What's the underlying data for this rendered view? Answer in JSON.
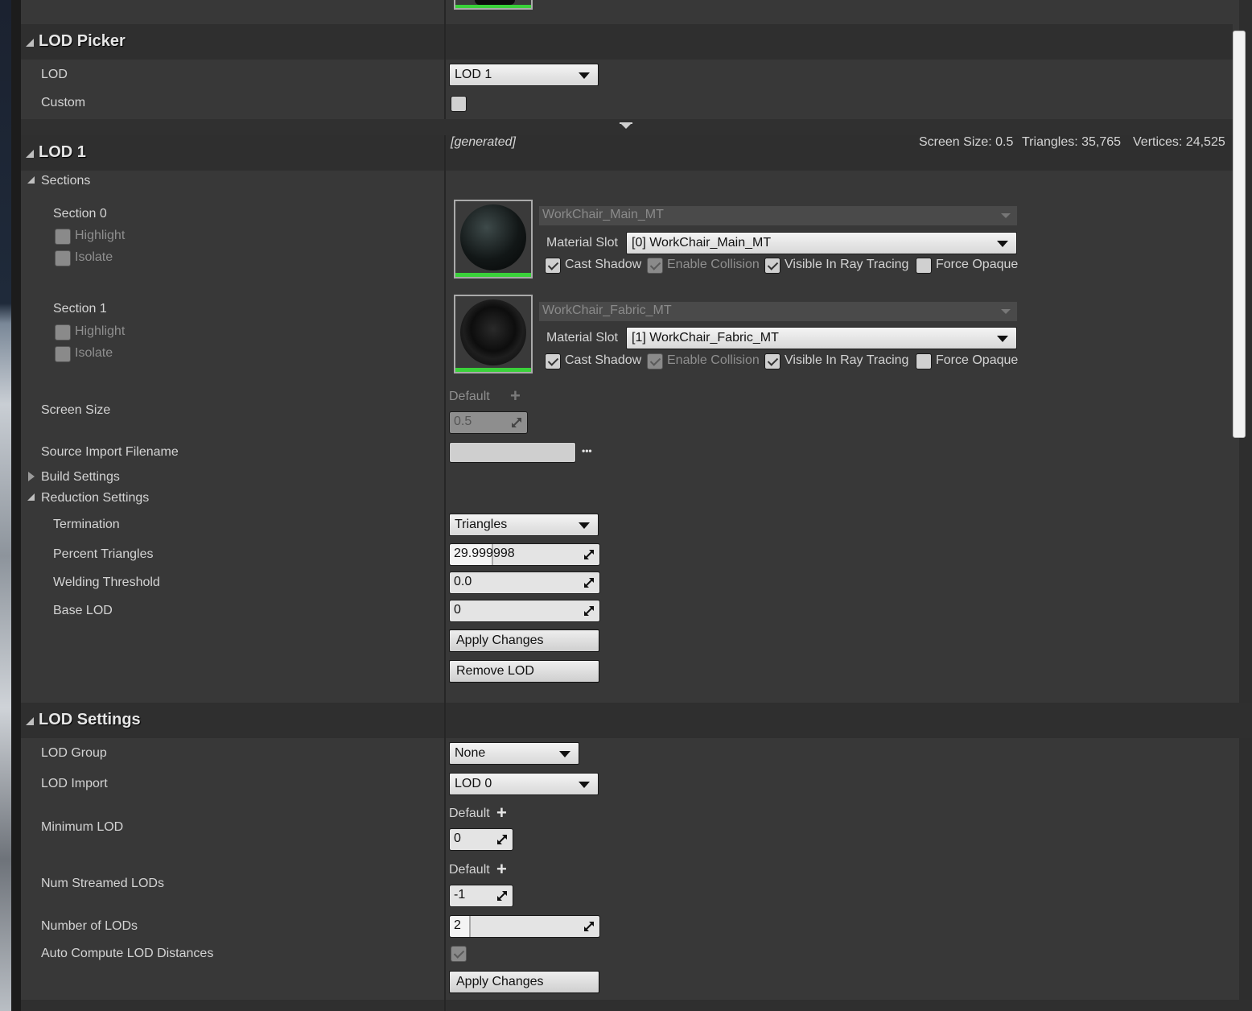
{
  "lod_picker": {
    "title": "LOD Picker",
    "lod_label": "LOD",
    "lod_value": "LOD 1",
    "custom_label": "Custom"
  },
  "lod1": {
    "title": "LOD 1",
    "generated": "[generated]",
    "screen_size_info": "Screen Size: 0.5",
    "triangles_info": "Triangles: 35,765",
    "vertices_info": "Vertices: 24,525",
    "sections_label": "Sections",
    "sections": [
      {
        "label": "Section 0",
        "highlight": "Highlight",
        "isolate": "Isolate",
        "material_name": "WorkChair_Main_MT",
        "material_slot_label": "Material Slot",
        "material_slot_value": "[0] WorkChair_Main_MT",
        "cast_shadow": "Cast Shadow",
        "enable_collision": "Enable Collision",
        "visible_ray_tracing": "Visible In Ray Tracing",
        "force_opaque": "Force Opaque"
      },
      {
        "label": "Section 1",
        "highlight": "Highlight",
        "isolate": "Isolate",
        "material_name": "WorkChair_Fabric_MT",
        "material_slot_label": "Material Slot",
        "material_slot_value": "[1] WorkChair_Fabric_MT",
        "cast_shadow": "Cast Shadow",
        "enable_collision": "Enable Collision",
        "visible_ray_tracing": "Visible In Ray Tracing",
        "force_opaque": "Force Opaque"
      }
    ],
    "screen_size_label": "Screen Size",
    "screen_size_default": "Default",
    "screen_size_value": "0.5",
    "source_import_label": "Source Import Filename",
    "source_import_value": "",
    "source_import_more": "•••",
    "build_settings_label": "Build Settings",
    "reduction_settings_label": "Reduction Settings",
    "termination_label": "Termination",
    "termination_value": "Triangles",
    "percent_triangles_label": "Percent Triangles",
    "percent_triangles_value": "29.999998",
    "welding_label": "Welding Threshold",
    "welding_value": "0.0",
    "base_lod_label": "Base LOD",
    "base_lod_value": "0",
    "apply_changes": "Apply Changes",
    "remove_lod": "Remove LOD"
  },
  "lod_settings": {
    "title": "LOD Settings",
    "lod_group_label": "LOD Group",
    "lod_group_value": "None",
    "lod_import_label": "LOD Import",
    "lod_import_value": "LOD 0",
    "minimum_lod_label": "Minimum LOD",
    "minimum_lod_default": "Default",
    "minimum_lod_value": "0",
    "num_streamed_label": "Num Streamed LODs",
    "num_streamed_default": "Default",
    "num_streamed_value": "-1",
    "number_of_lods_label": "Number of LODs",
    "number_of_lods_value": "2",
    "auto_compute_label": "Auto Compute LOD Distances",
    "apply_changes": "Apply Changes"
  },
  "colors": {
    "panel_bg": "#383838",
    "category_bg": "#2f2f2f",
    "thumb_bar": "#3ad13a"
  }
}
